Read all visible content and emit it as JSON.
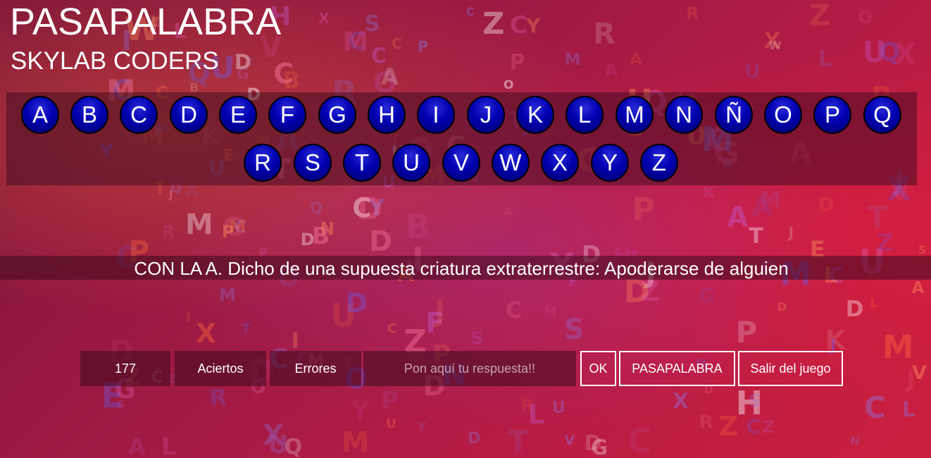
{
  "header": {
    "title": "PASAPALABRA",
    "subtitle": "SKYLAB CODERS"
  },
  "rosco": {
    "letters": [
      "A",
      "B",
      "C",
      "D",
      "E",
      "F",
      "G",
      "H",
      "I",
      "J",
      "K",
      "L",
      "M",
      "N",
      "Ñ",
      "O",
      "P",
      "Q",
      "R",
      "S",
      "T",
      "U",
      "V",
      "W",
      "X",
      "Y",
      "Z"
    ]
  },
  "question": {
    "text": "CON LA A. Dicho de una supuesta criatura extraterrestre: Apoderarse de alguien"
  },
  "stats": {
    "timer": "177",
    "correct_label": "Aciertos",
    "errors_label": "Errores"
  },
  "answer": {
    "placeholder": "Pon aquí tu respuesta!!",
    "value": ""
  },
  "buttons": {
    "ok": "OK",
    "pasapalabra": "PASAPALABRA",
    "exit": "Salir del juego"
  },
  "colors": {
    "letter_fill": "#0000b0",
    "background": "#a01a44"
  }
}
